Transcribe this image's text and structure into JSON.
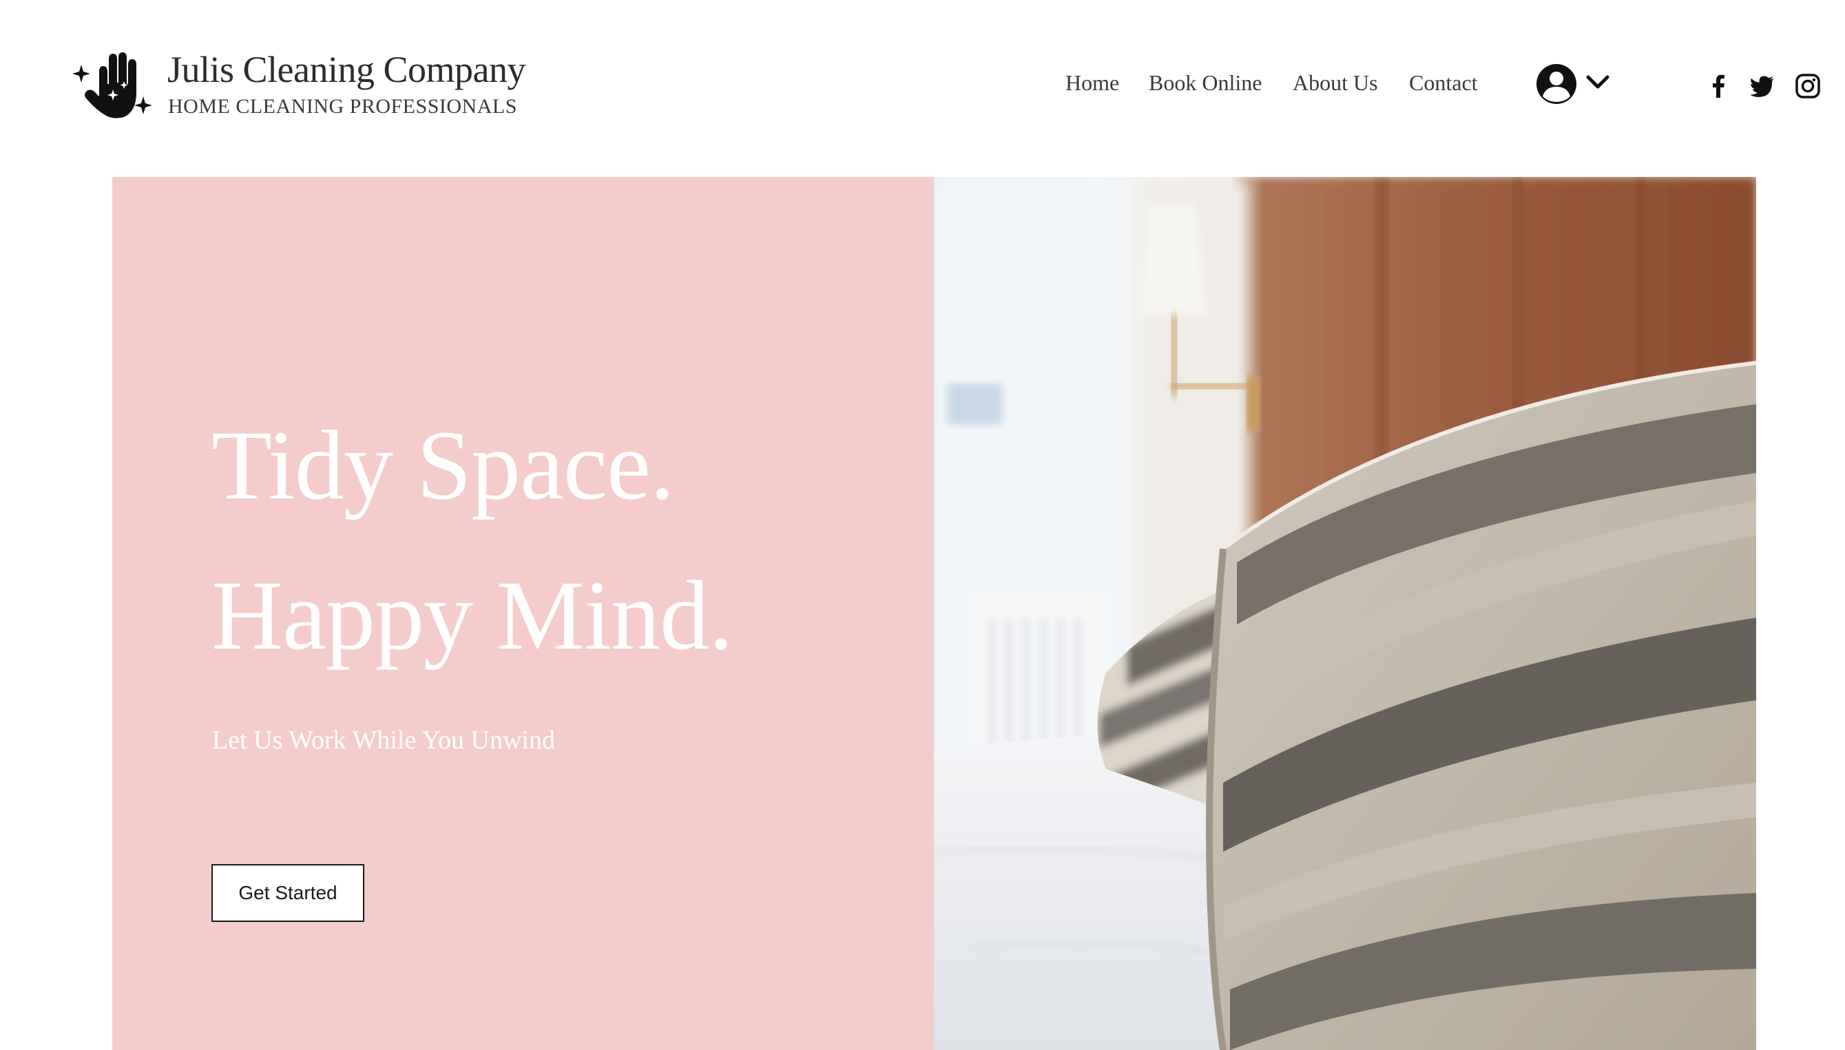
{
  "brand": {
    "name": "Julis Cleaning Company",
    "tagline": "HOME CLEANING PROFESSIONALS",
    "logo_icon": "sparkle-hand-icon"
  },
  "nav": {
    "items": [
      {
        "label": "Home"
      },
      {
        "label": "Book Online"
      },
      {
        "label": "About Us"
      },
      {
        "label": "Contact"
      }
    ]
  },
  "account": {
    "icon": "user-avatar-icon",
    "dropdown_icon": "chevron-down-icon"
  },
  "social": [
    {
      "name": "facebook-icon"
    },
    {
      "name": "twitter-icon"
    },
    {
      "name": "instagram-icon"
    }
  ],
  "hero": {
    "title_line1": "Tidy Space.",
    "title_line2": "Happy Mind.",
    "subtitle": "Let Us Work While You Unwind",
    "cta_label": "Get Started",
    "image": "bed-with-striped-pillows-photo"
  },
  "colors": {
    "hero_panel": "#f5cccc",
    "text_dark": "#2c2c2c",
    "white": "#ffffff"
  }
}
